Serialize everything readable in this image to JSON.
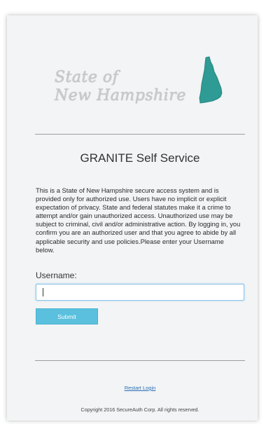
{
  "logo": {
    "line1": "State of",
    "line2": "New Hampshire",
    "shape_icon": "new-hampshire-state-shape",
    "shape_color": "#2e9b95"
  },
  "page_title": "GRANITE Self Service",
  "notice": "This is a State of New Hampshire secure access system and is provided only for authorized use. Users have no implicit or explicit expectation of privacy. State and federal statutes make it a crime to attempt and/or gain unauthorized access. Unauthorized use may be subject to criminal, civil and/or administrative action. By logging in, you confirm you are an authorized user and that you agree to abide by all applicable security and use policies.Please enter your Username below.",
  "form": {
    "username_label": "Username:",
    "username_value": "",
    "submit_label": "Submit"
  },
  "footer": {
    "restart_link": "Restart Login",
    "copyright": "Copyright 2016 SecureAuth Corp. All rights reserved."
  },
  "colors": {
    "accent": "#5bc0de",
    "link": "#2a6fb7",
    "background": "#f2f4f5"
  }
}
